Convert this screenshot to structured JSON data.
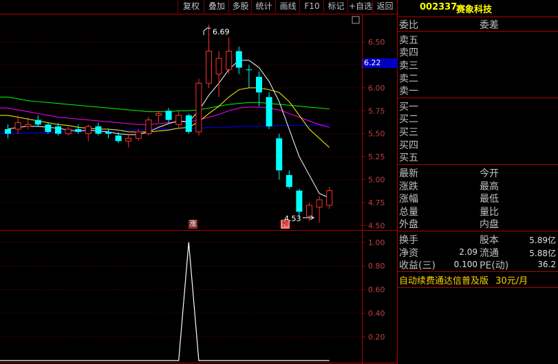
{
  "toolbar": {
    "buttons": [
      "复权",
      "叠加",
      "多股",
      "统计",
      "画线",
      "F10",
      "标记",
      "+自选",
      "返回"
    ]
  },
  "stock": {
    "code": "002337",
    "name": "赛象科技"
  },
  "price_tag": "6.22",
  "main_axis": [
    "6.50",
    "6.25",
    "6.00",
    "5.75",
    "5.50",
    "5.25",
    "5.00",
    "4.75",
    "4.50"
  ],
  "sub_axis": [
    "1.00",
    "0.80",
    "0.60",
    "0.40",
    "0.20"
  ],
  "annotations": {
    "high": "6.69",
    "low": "4.53",
    "mark_zhang": "涨",
    "mark_yu": "预"
  },
  "order_book": {
    "weibi": "委比",
    "weicha": "委差",
    "sells": [
      "卖五",
      "卖四",
      "卖三",
      "卖二",
      "卖一"
    ],
    "buys": [
      "买一",
      "买二",
      "买三",
      "买四",
      "买五"
    ]
  },
  "quote": {
    "left": [
      "最新",
      "涨跌",
      "涨幅",
      "总量",
      "外盘"
    ],
    "right": [
      "今开",
      "最高",
      "最低",
      "量比",
      "内盘"
    ]
  },
  "stats": {
    "huanshou": "换手",
    "guben": "股本",
    "guben_val": "5.89亿",
    "jingzi": "净资",
    "jingzi_val": "2.09",
    "liutong": "流通",
    "liutong_val": "5.88亿",
    "shouyi": "收益(三)",
    "shouyi_val": "0.100",
    "pe": "PE(动)",
    "pe_val": "36.2"
  },
  "ad": {
    "text": "自动续费通达信普及版",
    "price": "30元/月"
  },
  "colors": {
    "up": "#ff3030",
    "down": "#00ffff",
    "ma5": "#ffffff",
    "ma10": "#ffff00",
    "ma20": "#ff00ff",
    "ma30": "#00ff00",
    "ma60": "#0000ff"
  },
  "chart_data": {
    "type": "candlestick",
    "y_range": [
      4.45,
      6.8
    ],
    "candles": [
      {
        "o": 5.55,
        "h": 5.6,
        "l": 5.45,
        "c": 5.5,
        "dir": "down"
      },
      {
        "o": 5.55,
        "h": 5.7,
        "l": 5.5,
        "c": 5.62,
        "dir": "up"
      },
      {
        "o": 5.6,
        "h": 5.68,
        "l": 5.55,
        "c": 5.58,
        "dir": "up"
      },
      {
        "o": 5.65,
        "h": 5.7,
        "l": 5.58,
        "c": 5.6,
        "dir": "down"
      },
      {
        "o": 5.6,
        "h": 5.62,
        "l": 5.5,
        "c": 5.52,
        "dir": "down"
      },
      {
        "o": 5.58,
        "h": 5.62,
        "l": 5.48,
        "c": 5.5,
        "dir": "down"
      },
      {
        "o": 5.5,
        "h": 5.58,
        "l": 5.48,
        "c": 5.55,
        "dir": "up"
      },
      {
        "o": 5.55,
        "h": 5.6,
        "l": 5.5,
        "c": 5.52,
        "dir": "down"
      },
      {
        "o": 5.5,
        "h": 5.6,
        "l": 5.42,
        "c": 5.58,
        "dir": "up"
      },
      {
        "o": 5.58,
        "h": 5.62,
        "l": 5.48,
        "c": 5.5,
        "dir": "down"
      },
      {
        "o": 5.52,
        "h": 5.55,
        "l": 5.45,
        "c": 5.5,
        "dir": "down"
      },
      {
        "o": 5.48,
        "h": 5.52,
        "l": 5.4,
        "c": 5.42,
        "dir": "down"
      },
      {
        "o": 5.42,
        "h": 5.5,
        "l": 5.35,
        "c": 5.45,
        "dir": "up"
      },
      {
        "o": 5.45,
        "h": 5.55,
        "l": 5.42,
        "c": 5.52,
        "dir": "up"
      },
      {
        "o": 5.5,
        "h": 5.68,
        "l": 5.48,
        "c": 5.65,
        "dir": "up"
      },
      {
        "o": 5.7,
        "h": 5.75,
        "l": 5.62,
        "c": 5.72,
        "dir": "up"
      },
      {
        "o": 5.75,
        "h": 5.78,
        "l": 5.62,
        "c": 5.65,
        "dir": "down"
      },
      {
        "o": 5.6,
        "h": 5.75,
        "l": 5.55,
        "c": 5.7,
        "dir": "up"
      },
      {
        "o": 5.7,
        "h": 5.72,
        "l": 5.5,
        "c": 5.52,
        "dir": "down"
      },
      {
        "o": 5.52,
        "h": 6.1,
        "l": 5.48,
        "c": 6.05,
        "dir": "up"
      },
      {
        "o": 6.05,
        "h": 6.69,
        "l": 6.0,
        "c": 6.4,
        "dir": "up"
      },
      {
        "o": 6.15,
        "h": 6.4,
        "l": 5.9,
        "c": 6.32,
        "dir": "up"
      },
      {
        "o": 6.2,
        "h": 6.55,
        "l": 6.15,
        "c": 6.4,
        "dir": "up"
      },
      {
        "o": 6.4,
        "h": 6.45,
        "l": 6.15,
        "c": 6.22,
        "dir": "down"
      },
      {
        "o": 6.2,
        "h": 6.25,
        "l": 6.0,
        "c": 6.2,
        "dir": "down"
      },
      {
        "o": 6.12,
        "h": 6.18,
        "l": 5.8,
        "c": 5.95,
        "dir": "down"
      },
      {
        "o": 5.9,
        "h": 5.95,
        "l": 5.55,
        "c": 5.58,
        "dir": "down"
      },
      {
        "o": 5.45,
        "h": 5.5,
        "l": 5.0,
        "c": 5.1,
        "dir": "down"
      },
      {
        "o": 5.05,
        "h": 5.1,
        "l": 4.9,
        "c": 4.92,
        "dir": "down"
      },
      {
        "o": 4.88,
        "h": 4.9,
        "l": 4.6,
        "c": 4.65,
        "dir": "down"
      },
      {
        "o": 4.6,
        "h": 4.75,
        "l": 4.55,
        "c": 4.72,
        "dir": "up"
      },
      {
        "o": 4.7,
        "h": 4.82,
        "l": 4.53,
        "c": 4.78,
        "dir": "up"
      },
      {
        "o": 4.72,
        "h": 4.92,
        "l": 4.68,
        "c": 4.88,
        "dir": "up"
      }
    ],
    "ma5": [
      5.55,
      5.57,
      5.58,
      5.58,
      5.57,
      5.56,
      5.54,
      5.53,
      5.54,
      5.53,
      5.52,
      5.5,
      5.49,
      5.49,
      5.52,
      5.57,
      5.61,
      5.64,
      5.63,
      5.75,
      5.92,
      6.05,
      6.2,
      6.3,
      6.3,
      6.22,
      6.07,
      5.85,
      5.55,
      5.25,
      5.05,
      4.85,
      4.8
    ],
    "ma10": [
      5.7,
      5.68,
      5.66,
      5.64,
      5.62,
      5.6,
      5.59,
      5.57,
      5.56,
      5.55,
      5.55,
      5.54,
      5.52,
      5.52,
      5.52,
      5.53,
      5.54,
      5.56,
      5.57,
      5.63,
      5.72,
      5.8,
      5.9,
      5.98,
      6.0,
      6.0,
      5.98,
      5.95,
      5.85,
      5.7,
      5.55,
      5.45,
      5.35
    ],
    "ma20": [
      5.78,
      5.76,
      5.74,
      5.72,
      5.7,
      5.68,
      5.67,
      5.66,
      5.65,
      5.64,
      5.63,
      5.62,
      5.61,
      5.6,
      5.6,
      5.61,
      5.62,
      5.63,
      5.63,
      5.65,
      5.68,
      5.71,
      5.75,
      5.78,
      5.79,
      5.79,
      5.78,
      5.76,
      5.72,
      5.68,
      5.64,
      5.6,
      5.57
    ],
    "ma30": [
      5.9,
      5.88,
      5.86,
      5.85,
      5.84,
      5.83,
      5.82,
      5.81,
      5.8,
      5.79,
      5.78,
      5.77,
      5.76,
      5.75,
      5.74,
      5.74,
      5.74,
      5.75,
      5.75,
      5.76,
      5.78,
      5.8,
      5.82,
      5.83,
      5.84,
      5.84,
      5.83,
      5.82,
      5.81,
      5.8,
      5.79,
      5.78,
      5.77
    ],
    "ma60": [
      5.5,
      5.5,
      5.51,
      5.51,
      5.51,
      5.52,
      5.52,
      5.52,
      5.53,
      5.53,
      5.53,
      5.54,
      5.54,
      5.54,
      5.55,
      5.55,
      5.55,
      5.56,
      5.56,
      5.56,
      5.57,
      5.57,
      5.57,
      5.58,
      5.58,
      5.58,
      5.58,
      5.59,
      5.59,
      5.59,
      5.59,
      5.6,
      5.6
    ],
    "indicator": {
      "y_range": [
        0,
        1.08
      ],
      "values": [
        0,
        0,
        0,
        0,
        0,
        0,
        0,
        0,
        0,
        0,
        0,
        0,
        0,
        0,
        0,
        0,
        0,
        0,
        1.0,
        0,
        0,
        0,
        0,
        0,
        0,
        0,
        0,
        0,
        0,
        0,
        0,
        0,
        0
      ]
    }
  }
}
